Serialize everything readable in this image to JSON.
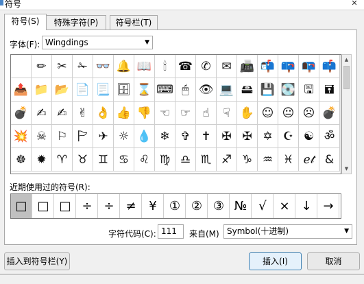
{
  "window": {
    "title": "符号",
    "close_glyph": "✕"
  },
  "tabs": [
    {
      "label": "符号(S)",
      "active": true
    },
    {
      "label": "特殊字符(P)",
      "active": false
    },
    {
      "label": "符号栏(T)",
      "active": false
    }
  ],
  "font": {
    "label": "字体(F):",
    "value": "Wingdings"
  },
  "grid": {
    "rows": [
      [
        "",
        "✏",
        "✂",
        "✁",
        "👓",
        "🔔",
        "📖",
        "🕯",
        "☎",
        "✆",
        "✉",
        "📠",
        "📬",
        "📪",
        "📭",
        "📫"
      ],
      [
        "📤",
        "📁",
        "📂",
        "📄",
        "📃",
        "🗄",
        "⌛",
        "⌨",
        "🖱",
        "👁",
        "💻",
        "🖴",
        "💾",
        "💽",
        "🖫",
        "🖬"
      ],
      [
        "💣",
        "✍",
        "✍",
        "✌",
        "👌",
        "👍",
        "👎",
        "☜",
        "☞",
        "☝",
        "☟",
        "✋",
        "☺",
        "😐",
        "☹",
        "💣"
      ],
      [
        "💥",
        "☠",
        "⚐",
        "🏱",
        "✈",
        "☼",
        "💧",
        "❄",
        "✞",
        "✝",
        "✠",
        "✠",
        "✡",
        "☪",
        "☯",
        "ॐ"
      ],
      [
        "☸",
        "✹",
        "♈",
        "♉",
        "♊",
        "♋",
        "♌",
        "♍",
        "♎",
        "♏",
        "♐",
        "♑",
        "♒",
        "♓",
        "ℯ𝓉",
        "&"
      ]
    ]
  },
  "recent": {
    "label": "近期使用过的符号(R):",
    "symbols": [
      "□",
      "□",
      "□",
      "÷",
      "÷",
      "≠",
      "¥",
      "①",
      "②",
      "③",
      "№",
      "√",
      "×",
      "↓",
      "→"
    ],
    "selected_index": 0
  },
  "char_code": {
    "label": "字符代码(C):",
    "value": "111"
  },
  "from": {
    "label": "来自(M)",
    "value": "Symbol(十进制)"
  },
  "buttons": {
    "insert_to_bar": "插入到符号栏(Y)",
    "insert": "插入(I)",
    "cancel": "取消"
  }
}
